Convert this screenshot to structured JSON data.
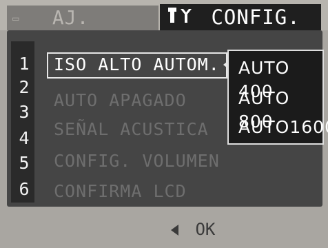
{
  "tabs": {
    "film": {
      "label": "AJ. FILM.",
      "icon": "camera-film-icon"
    },
    "config": {
      "label": "CONFIG.",
      "icon": "tools-icon"
    }
  },
  "menu": {
    "numbers": [
      "1",
      "2",
      "3",
      "4",
      "5",
      "6"
    ],
    "items": [
      {
        "label": "ISO ALTO AUTOM."
      },
      {
        "label": "AUTO APAGADO"
      },
      {
        "label": "SEÑAL ACUSTICA"
      },
      {
        "label": "CONFIG. VOLUMEN"
      },
      {
        "label": "CONFIRMA LCD"
      }
    ]
  },
  "dropdown": {
    "options": [
      "AUTO 400",
      "AUTO 800",
      "AUTO1600"
    ]
  },
  "footer": {
    "ok_label": "OK"
  },
  "colors": {
    "background": "#a9a6a1",
    "panel": "#454545",
    "active_tab": "#1f1f1f",
    "text_active": "#ffffff",
    "text_dim": "#6e6e6e"
  }
}
